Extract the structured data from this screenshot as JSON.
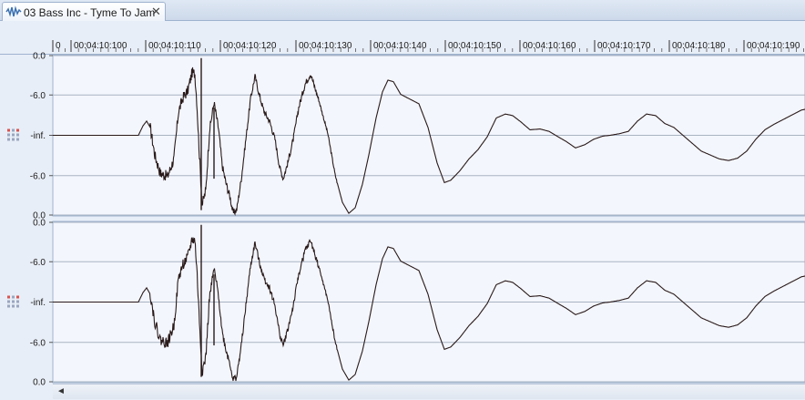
{
  "tab": {
    "title": "03 Bass Inc - Tyme To Jam",
    "close_glyph": "✕",
    "icon": "waveform-icon"
  },
  "ruler": {
    "labels": [
      "0",
      "00:04:10:100",
      "00:04:10:110",
      "00:04:10:120",
      "00:04:10:130",
      "00:04:10:140",
      "00:04:10:150",
      "00:04:10:160",
      "00:04:10:170",
      "00:04:10:180",
      "00:04:10:190"
    ]
  },
  "tracks": [
    {
      "name": "channel-1",
      "axis_labels": [
        "0.0",
        "-6.0",
        "-inf.",
        "-6.0",
        "0.0"
      ]
    },
    {
      "name": "channel-2",
      "axis_labels": [
        "0.0",
        "-6.0",
        "-inf.",
        "-6.0",
        "0.0"
      ]
    }
  ],
  "scrollbar": {
    "left_arrow": "◄"
  },
  "colors": {
    "waveform": "#2a1a1a",
    "background": "#f3f6fc",
    "gridline": "#a9b4c3",
    "accent": "#d9534f"
  }
}
